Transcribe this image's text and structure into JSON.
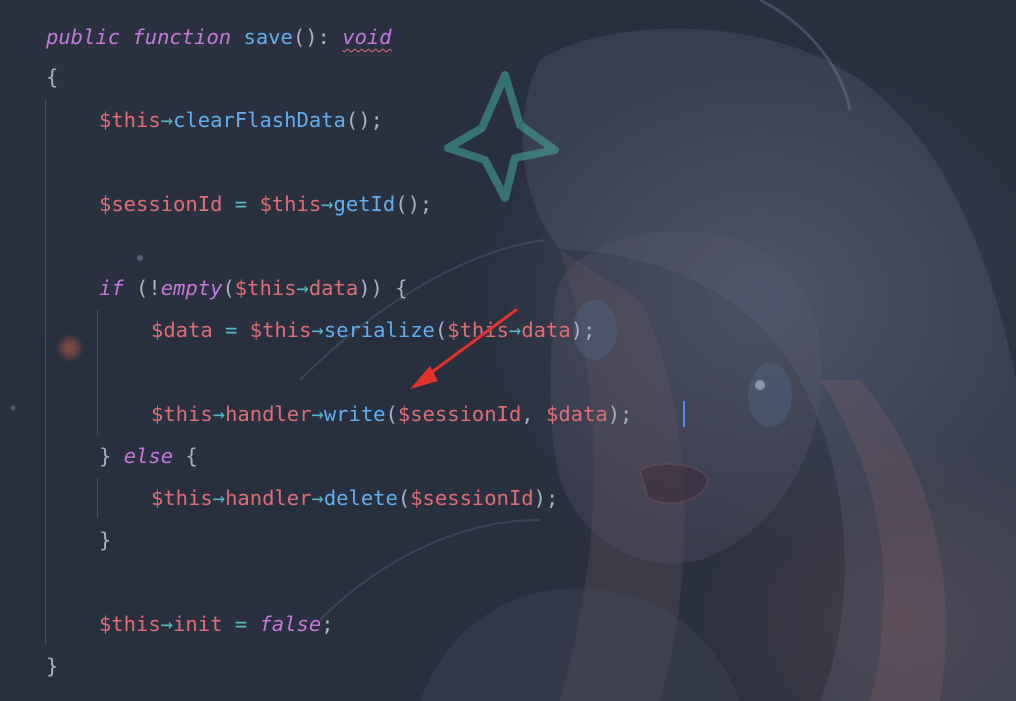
{
  "code_lines": [
    {
      "id": "signature",
      "tokens": [
        {
          "t": "public",
          "c": "kw"
        },
        {
          "t": " ",
          "c": "punc"
        },
        {
          "t": "function",
          "c": "kw"
        },
        {
          "t": " ",
          "c": "punc"
        },
        {
          "t": "save",
          "c": "fn"
        },
        {
          "t": "(): ",
          "c": "punc"
        },
        {
          "t": "void",
          "c": "void"
        }
      ]
    },
    {
      "id": "open-brace",
      "tokens": [
        {
          "t": "{",
          "c": "punc"
        }
      ]
    },
    {
      "id": "clear-flash",
      "tokens": [
        {
          "t": "$this",
          "c": "var"
        },
        {
          "t": "→",
          "c": "op"
        },
        {
          "t": "clearFlashData",
          "c": "fn"
        },
        {
          "t": "();",
          "c": "punc"
        }
      ]
    },
    {
      "id": "session-id",
      "tokens": [
        {
          "t": "$sessionId",
          "c": "var"
        },
        {
          "t": " = ",
          "c": "op"
        },
        {
          "t": "$this",
          "c": "var"
        },
        {
          "t": "→",
          "c": "op"
        },
        {
          "t": "getId",
          "c": "fn"
        },
        {
          "t": "();",
          "c": "punc"
        }
      ]
    },
    {
      "id": "if-line",
      "tokens": [
        {
          "t": "if",
          "c": "kw"
        },
        {
          "t": " (!",
          "c": "punc"
        },
        {
          "t": "empty",
          "c": "kw"
        },
        {
          "t": "(",
          "c": "punc"
        },
        {
          "t": "$this",
          "c": "var"
        },
        {
          "t": "→",
          "c": "op"
        },
        {
          "t": "data",
          "c": "var"
        },
        {
          "t": ")) {",
          "c": "punc"
        }
      ]
    },
    {
      "id": "serialize-line",
      "tokens": [
        {
          "t": "$data",
          "c": "var"
        },
        {
          "t": " = ",
          "c": "op"
        },
        {
          "t": "$this",
          "c": "var"
        },
        {
          "t": "→",
          "c": "op"
        },
        {
          "t": "serialize",
          "c": "fn"
        },
        {
          "t": "(",
          "c": "punc"
        },
        {
          "t": "$this",
          "c": "var"
        },
        {
          "t": "→",
          "c": "op"
        },
        {
          "t": "data",
          "c": "var"
        },
        {
          "t": ");",
          "c": "punc"
        }
      ]
    },
    {
      "id": "write-line",
      "tokens": [
        {
          "t": "$this",
          "c": "var"
        },
        {
          "t": "→",
          "c": "op"
        },
        {
          "t": "handler",
          "c": "var"
        },
        {
          "t": "→",
          "c": "op"
        },
        {
          "t": "write",
          "c": "fn"
        },
        {
          "t": "(",
          "c": "punc"
        },
        {
          "t": "$sessionId",
          "c": "var"
        },
        {
          "t": ", ",
          "c": "punc"
        },
        {
          "t": "$data",
          "c": "var"
        },
        {
          "t": ");",
          "c": "punc"
        }
      ]
    },
    {
      "id": "else-line",
      "tokens": [
        {
          "t": "} ",
          "c": "punc"
        },
        {
          "t": "else",
          "c": "kw"
        },
        {
          "t": " {",
          "c": "punc"
        }
      ]
    },
    {
      "id": "delete-line",
      "tokens": [
        {
          "t": "$this",
          "c": "var"
        },
        {
          "t": "→",
          "c": "op"
        },
        {
          "t": "handler",
          "c": "var"
        },
        {
          "t": "→",
          "c": "op"
        },
        {
          "t": "delete",
          "c": "fn"
        },
        {
          "t": "(",
          "c": "punc"
        },
        {
          "t": "$sessionId",
          "c": "var"
        },
        {
          "t": ");",
          "c": "punc"
        }
      ]
    },
    {
      "id": "close-if",
      "tokens": [
        {
          "t": "}",
          "c": "punc"
        }
      ]
    },
    {
      "id": "init-line",
      "tokens": [
        {
          "t": "$this",
          "c": "var"
        },
        {
          "t": "→",
          "c": "op"
        },
        {
          "t": "init",
          "c": "var"
        },
        {
          "t": " = ",
          "c": "op"
        },
        {
          "t": "false",
          "c": "kw"
        },
        {
          "t": ";",
          "c": "punc"
        }
      ]
    },
    {
      "id": "close-method",
      "tokens": [
        {
          "t": "}",
          "c": "punc"
        }
      ]
    }
  ],
  "colors": {
    "keyword": "#c678dd",
    "function": "#61afef",
    "variable": "#e06c75",
    "operator": "#56b6c2",
    "caret": "#528bff",
    "annotation_arrow": "#e0332c"
  }
}
